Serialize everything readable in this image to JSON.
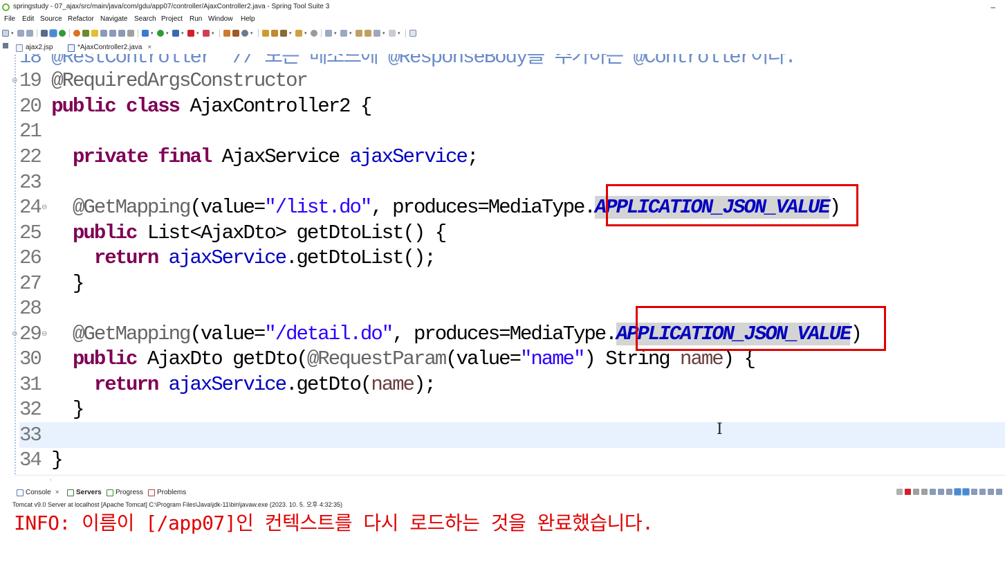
{
  "window": {
    "title": "springstudy - 07_ajax/src/main/java/com/gdu/app07/controller/AjaxController2.java - Spring Tool Suite 3",
    "minimize_label": "–"
  },
  "menu": [
    "File",
    "Edit",
    "Source",
    "Refactor",
    "Navigate",
    "Search",
    "Project",
    "Run",
    "Window",
    "Help"
  ],
  "editor_tabs": [
    {
      "label": "ajax2.jsp",
      "active": false
    },
    {
      "label": "*AjaxController2.java",
      "active": true,
      "close": "×"
    }
  ],
  "code": {
    "partial_line": "18 @RestController  // 모든 메소드에 @ResponseBody를 추가하는 @Controller이다.",
    "lines": [
      {
        "num": "19",
        "annotation": "@RequiredArgsConstructor"
      },
      {
        "num": "20",
        "kw": "public class",
        "rest": " AjaxController2 {"
      },
      {
        "num": "21"
      },
      {
        "num": "22",
        "kw": "private final",
        "type": " AjaxService ",
        "field": "ajaxService",
        "end": ";"
      },
      {
        "num": "23"
      },
      {
        "num": "24",
        "annotation": "@GetMapping",
        "p1": "(value=",
        "str": "\"/list.do\"",
        "p2": ", produces=MediaType.",
        "const": "APPLICATION_JSON_VALUE",
        "end": ")"
      },
      {
        "num": "25",
        "kw": "public",
        "rest": " List<AjaxDto> getDtoList() {"
      },
      {
        "num": "26",
        "kw": "return",
        "field": "ajaxService",
        "rest": ".getDtoList();"
      },
      {
        "num": "27",
        "rest": "}"
      },
      {
        "num": "28"
      },
      {
        "num": "29",
        "annotation": "@GetMapping",
        "p1": "(value=",
        "str": "\"/detail.do\"",
        "p2": ", produces=MediaType.",
        "const": "APPLICATION_JSON_VALUE",
        "end": ")"
      },
      {
        "num": "30",
        "kw": "public",
        "rest1": " AjaxDto getDto(",
        "annotation": "@RequestParam",
        "p1": "(value=",
        "str": "\"name\"",
        "p2": ") String ",
        "param": "name",
        "end": ") {"
      },
      {
        "num": "31",
        "kw": "return",
        "field": "ajaxService",
        "rest1": ".getDto(",
        "param": "name",
        "end": ");"
      },
      {
        "num": "32",
        "rest": "}"
      },
      {
        "num": "33"
      },
      {
        "num": "34",
        "rest": "}"
      }
    ]
  },
  "cursor_glyph": "I",
  "scroll_glyph": "‹",
  "console_tabs": [
    {
      "label": "Console",
      "close": "×"
    },
    {
      "label": "Servers"
    },
    {
      "label": "Progress"
    },
    {
      "label": "Problems"
    }
  ],
  "console": {
    "description": "Tomcat v9.0 Server at localhost [Apache Tomcat] C:\\Program Files\\Java\\jdk-11\\bin\\javaw.exe  (2023. 10. 5. 오후 4:32:35)",
    "output": "INFO: 이름이 [/app07]인 컨텍스트를 다시 로드하는 것을 완료했습니다."
  },
  "colors": {
    "keyword": "#7f0055",
    "string": "#2a00ff",
    "field": "#0000c0",
    "annotation": "#646464",
    "highlight_box": "#e00000",
    "console_output": "#e00000"
  }
}
